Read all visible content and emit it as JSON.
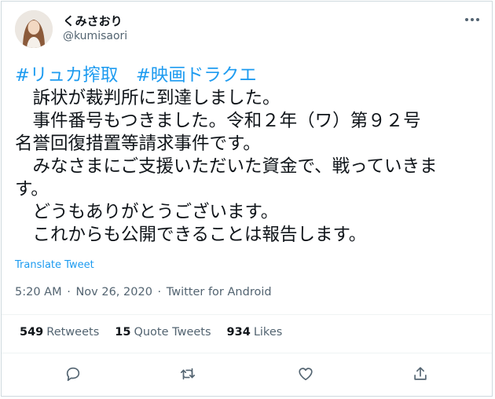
{
  "author": {
    "display_name": "くみさおり",
    "handle": "@kumisaori"
  },
  "tweet": {
    "hashtags": [
      "#リュカ搾取",
      "#映画ドラクエ"
    ],
    "lines": [
      "　訴状が裁判所に到達しました。",
      "　事件番号もつきました。令和２年（ワ）第９２号",
      "名誉回復措置等請求事件です。",
      "　みなさまにご支援いただいた資金で、戦っていきま",
      "す。",
      "　どうもありがとうございます。",
      "　これからも公開できることは報告します。"
    ],
    "translate_label": "Translate Tweet",
    "time": "5:20 AM",
    "date": "Nov 26, 2020",
    "source": "Twitter for Android",
    "separator": "·"
  },
  "stats": {
    "retweets_count": "549",
    "retweets_label": "Retweets",
    "quotes_count": "15",
    "quotes_label": "Quote Tweets",
    "likes_count": "934",
    "likes_label": "Likes"
  },
  "actions": {
    "icons": [
      "reply-icon",
      "retweet-icon",
      "like-icon",
      "share-icon"
    ]
  },
  "colors": {
    "link": "#1d9bf0",
    "text": "#0f1419",
    "secondary": "#536471",
    "border": "#cfd9de"
  }
}
